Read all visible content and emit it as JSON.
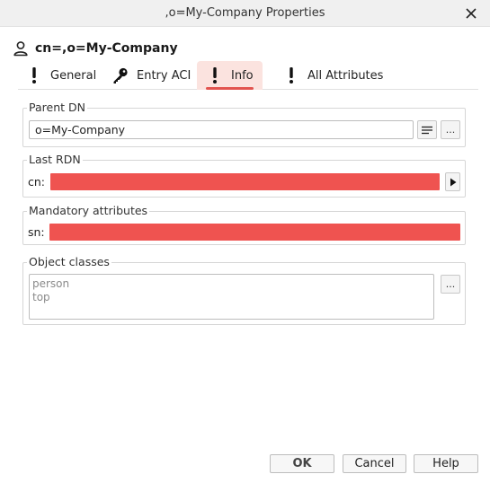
{
  "window": {
    "title": ",o=My-Company Properties"
  },
  "entry": {
    "dn": "cn=,o=My-Company"
  },
  "tabs": [
    {
      "label": "General",
      "icon": "exclamation-icon"
    },
    {
      "label": "Entry ACI",
      "icon": "key-icon"
    },
    {
      "label": "Info",
      "icon": "exclamation-icon",
      "active": true
    },
    {
      "label": "All Attributes",
      "icon": "exclamation-icon"
    }
  ],
  "parent_dn": {
    "legend": "Parent DN",
    "value": "o=My-Company",
    "browse_label": "..."
  },
  "last_rdn": {
    "legend": "Last RDN",
    "attr_label": "cn:"
  },
  "mandatory": {
    "legend": "Mandatory attributes",
    "attr_label": "sn:"
  },
  "object_classes": {
    "legend": "Object classes",
    "items": [
      "person",
      "top"
    ],
    "edit_label": "..."
  },
  "buttons": {
    "ok": "OK",
    "cancel": "Cancel",
    "help": "Help"
  },
  "colors": {
    "error_field": "#ef5350",
    "active_tab_bg": "#fbe3df",
    "active_tab_underline": "#e2544f"
  }
}
